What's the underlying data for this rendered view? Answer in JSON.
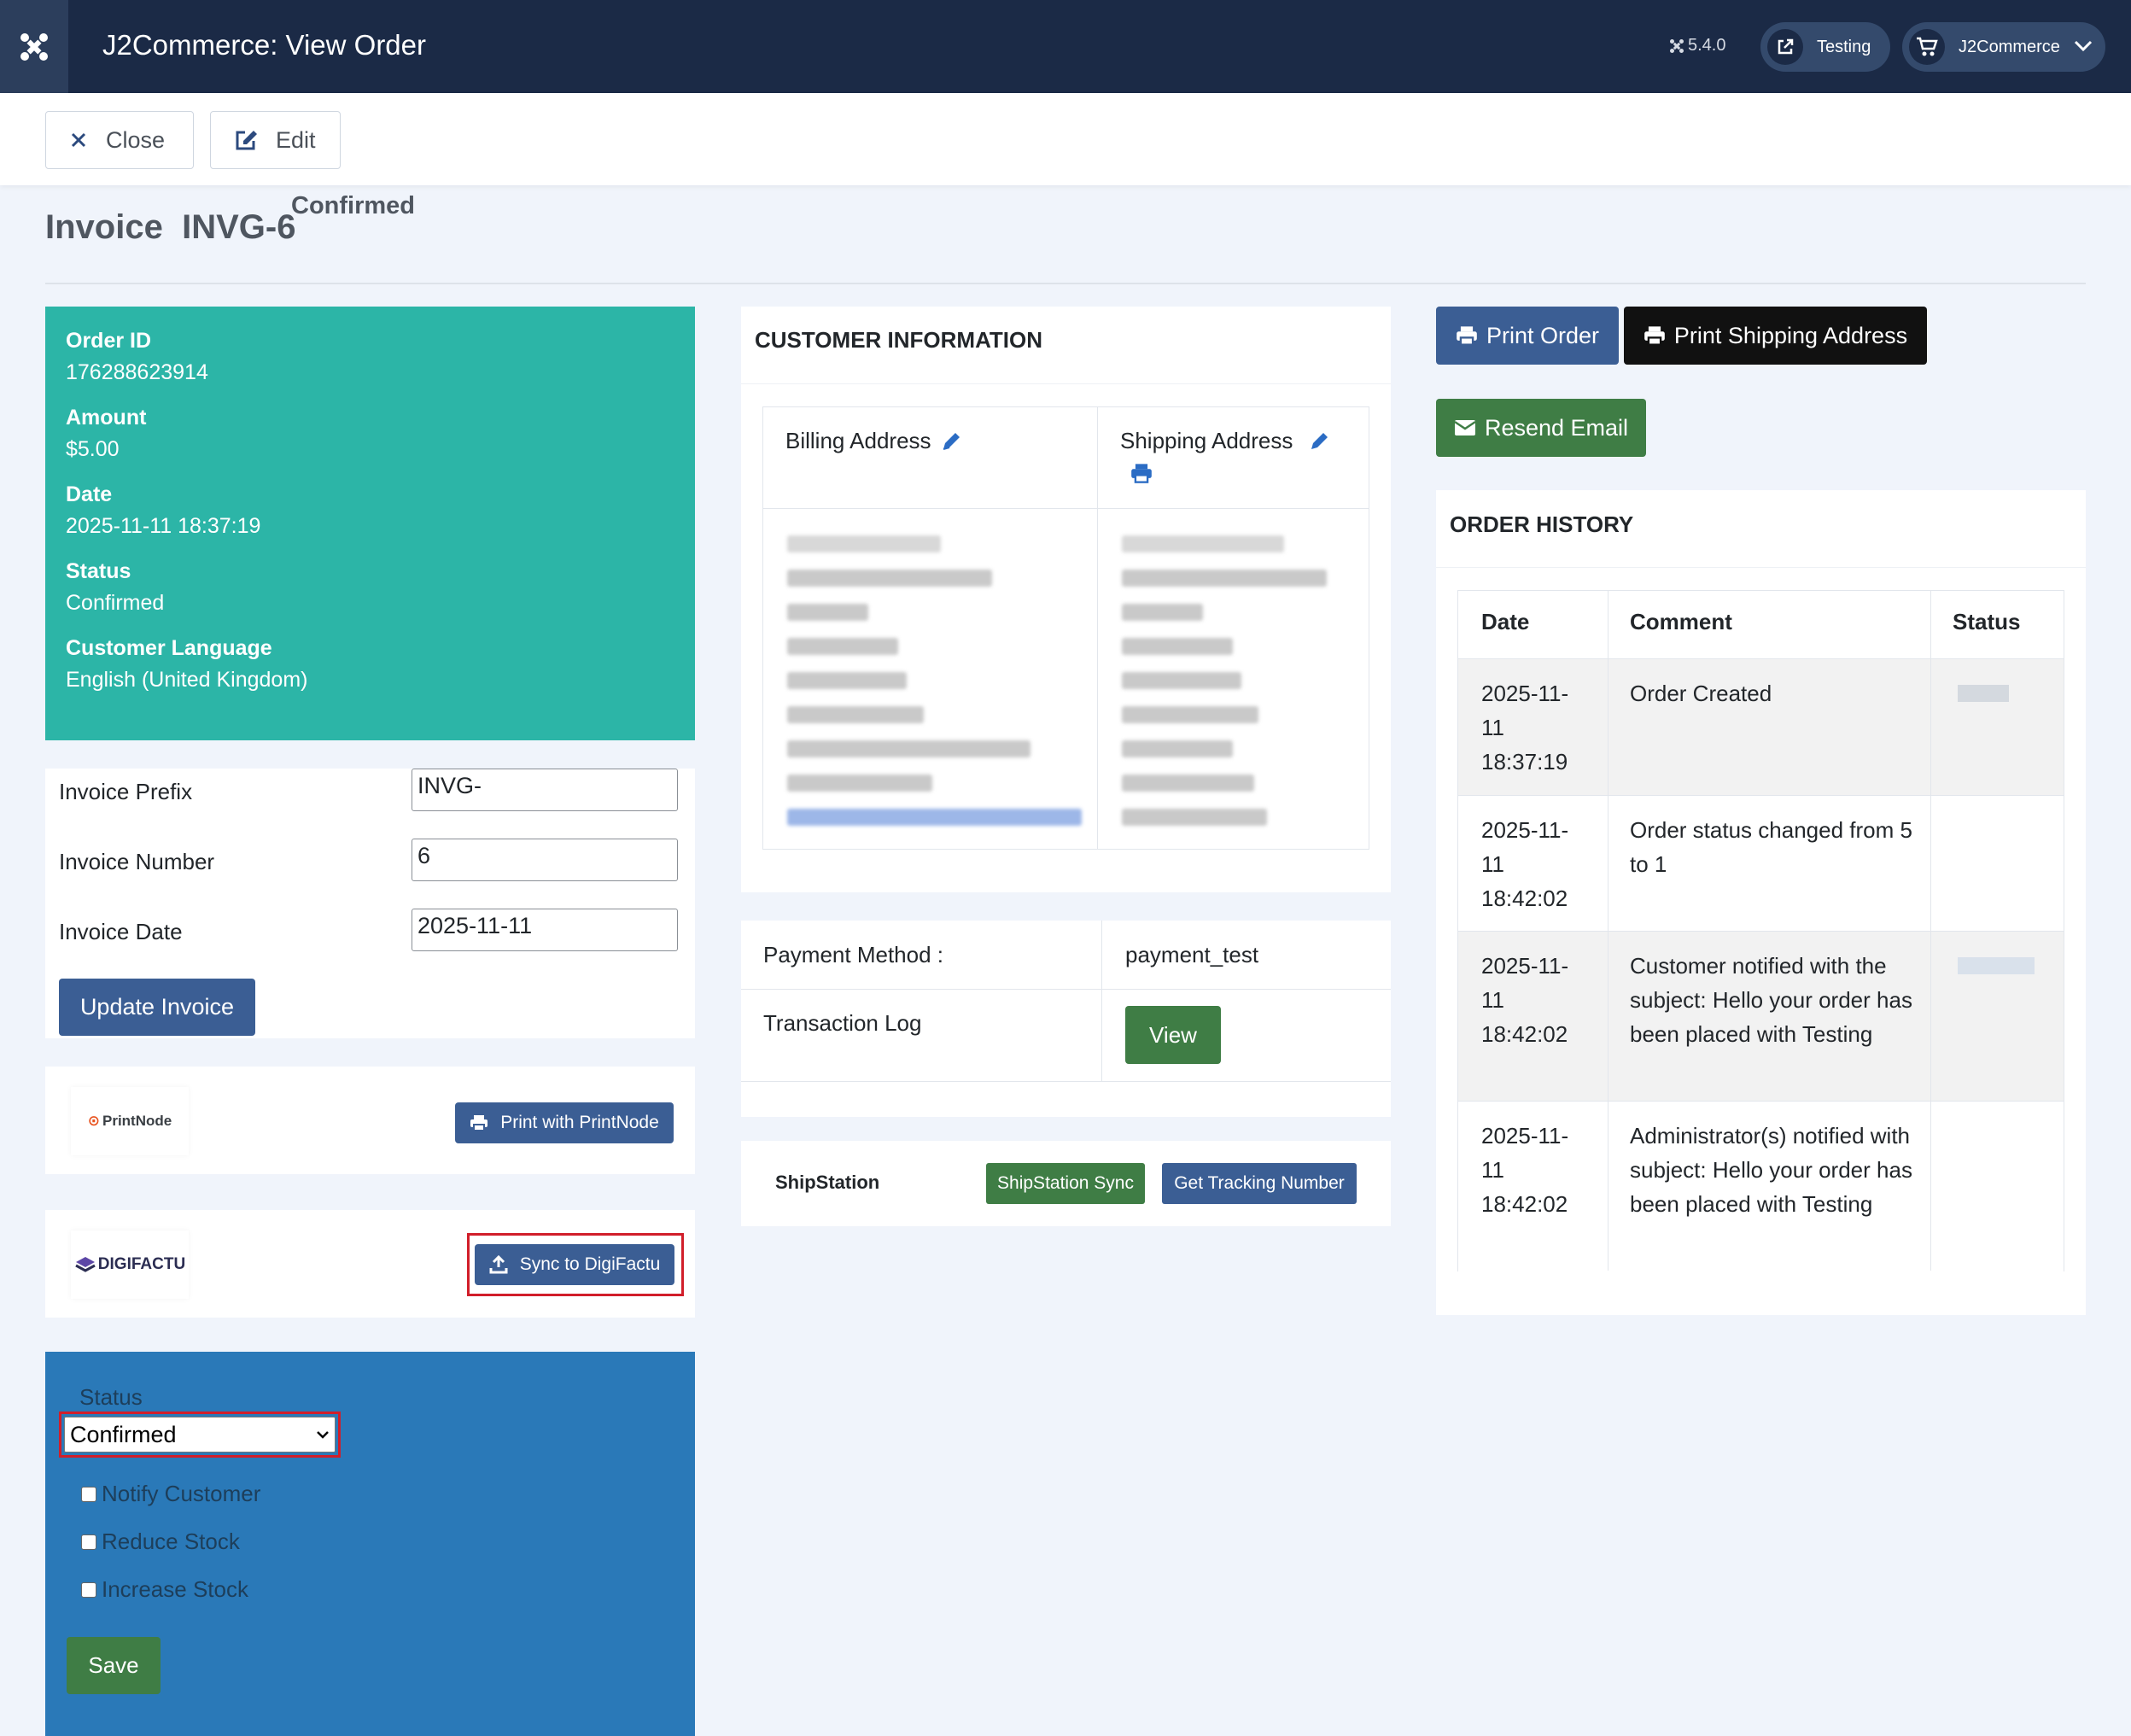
{
  "header": {
    "title": "J2Commerce: View Order",
    "version": "5.4.0",
    "site_label": "Testing",
    "menu_label": "J2Commerce"
  },
  "toolbar": {
    "close_label": "Close",
    "edit_label": "Edit"
  },
  "invoice": {
    "prefix_title": "Invoice",
    "number_title": "INVG-6",
    "status": "Confirmed"
  },
  "order_info": {
    "order_id_label": "Order ID",
    "order_id": "176288623914",
    "amount_label": "Amount",
    "amount": "$5.00",
    "date_label": "Date",
    "date": "2025-11-11 18:37:19",
    "status_label": "Status",
    "status": "Confirmed",
    "language_label": "Customer Language",
    "language": "English (United Kingdom)"
  },
  "invoice_form": {
    "prefix_label": "Invoice Prefix",
    "prefix_value": "INVG-",
    "number_label": "Invoice Number",
    "number_value": "6",
    "date_label": "Invoice Date",
    "date_value": "2025-11-11",
    "update_button": "Update Invoice"
  },
  "printnode": {
    "logo_text": "PrintNode",
    "button": "Print with PrintNode"
  },
  "digifactu": {
    "logo_text": "DIGIFACTU",
    "button": "Sync to DigiFactu"
  },
  "status_form": {
    "label": "Status",
    "selected": "Confirmed",
    "notify": "Notify Customer",
    "reduce": "Reduce Stock",
    "increase": "Increase Stock",
    "save": "Save"
  },
  "customer": {
    "heading": "CUSTOMER INFORMATION",
    "billing_heading": "Billing Address",
    "shipping_heading": "Shipping Address"
  },
  "payment": {
    "method_label": "Payment Method :",
    "method_value": "payment_test",
    "log_label": "Transaction Log",
    "view_button": "View"
  },
  "shipstation": {
    "label": "ShipStation",
    "sync_button": "ShipStation Sync",
    "tracking_button": "Get Tracking Number"
  },
  "actions": {
    "print_order": "Print Order",
    "print_shipping": "Print Shipping Address",
    "resend_email": "Resend Email"
  },
  "history": {
    "heading": "ORDER HISTORY",
    "columns": [
      "Date",
      "Comment",
      "Status"
    ],
    "rows": [
      {
        "date": "2025-11-11 18:37:19",
        "comment": "Order Created"
      },
      {
        "date": "2025-11-11 18:42:02",
        "comment": "Order status changed from 5 to 1"
      },
      {
        "date": "2025-11-11 18:42:02",
        "comment": "Customer notified with the subject: Hello your order has been placed with Testing"
      },
      {
        "date": "2025-11-11 18:42:02",
        "comment": "Administrator(s) notified with subject: Hello your order has been placed with Testing"
      }
    ]
  },
  "colors": {
    "header_bg": "#1b2a46",
    "teal": "#2cb5a7",
    "primary": "#3b5e94",
    "success": "#3f7d45",
    "status_panel": "#2a79b8"
  }
}
